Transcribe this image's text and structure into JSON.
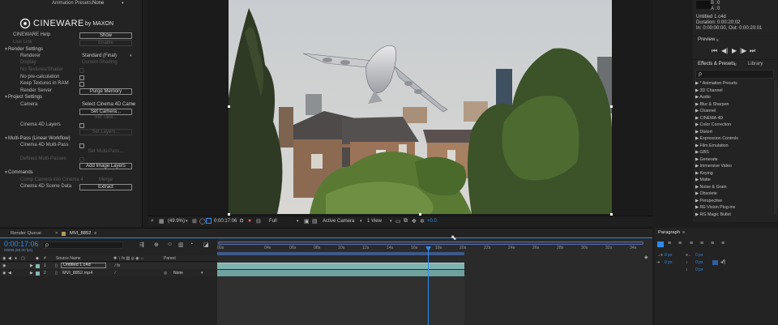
{
  "effect_controls": {
    "animation_presets_label": "Animation Presets:",
    "animation_presets_value": "None",
    "brand_name": "CINEWARE",
    "brand_by": "by MAXON",
    "help_label": "CINEWARE Help",
    "help_button": "Show",
    "live_link_label": "Live Link",
    "live_link_button": "Enable",
    "render_settings_label": "Render Settings",
    "renderer_label": "Renderer",
    "renderer_value": "Standard (Final)",
    "display_label": "Display",
    "display_value": "Current Shading",
    "no_textures_label": "No Textures/Shader",
    "no_precalc_label": "No pre-calculation",
    "keep_textures_label": "Keep Textures in RAM",
    "render_server_label": "Render Server",
    "render_server_button": "Purge Memory",
    "project_settings_label": "Project Settings",
    "camera_label": "Camera",
    "camera_value": "Select Cinema 4D Came",
    "set_camera_button": "Set Camera...",
    "set_take_button": "Set Take...",
    "c4d_layers_label": "Cinema 4D Layers",
    "set_layers_button": "Set Layers...",
    "multipass_label": "Multi-Pass (Linear Workflow)",
    "c4d_multipass_label": "Cinema 4D Multi-Pass",
    "set_multipass_button": "Set Multi-Pass...",
    "defined_multipasses_label": "Defined Multi-Passes",
    "add_image_layers_button": "Add Image Layers",
    "commands_label": "Commands",
    "comp_camera_label": "Comp Camera into Cinema 4",
    "merge_button": "Merge",
    "c4d_scene_data_label": "Cinema 4D Scene Data",
    "extract_button": "Extract"
  },
  "viewer_toolbar": {
    "zoom": "(49.9%)",
    "timecode": "0:00:17:06",
    "resolution": "Full",
    "camera": "Active Camera",
    "views": "1 View",
    "exposure": "+0.0"
  },
  "info_panel": {
    "b_label": "B :",
    "b_value": "0",
    "a_label": "A :",
    "a_value": "0",
    "comp_name": "Untitled 1.c4d",
    "duration": "Duration: 0:00:20:02",
    "in_out": "In: 0:00:00:00, Out: 0:00:20:01"
  },
  "preview_panel": {
    "title": "Preview"
  },
  "effects_panel": {
    "tab_effects": "Effects & Presets",
    "tab_library": "Library",
    "search_placeholder": "ρ",
    "items": [
      "* Animation Presets",
      "3D Channel",
      "Audio",
      "Blur & Sharpen",
      "Channel",
      "CINEMA 4D",
      "Color Correction",
      "Distort",
      "Expression Controls",
      "Film Emulation",
      "GBS",
      "Generate",
      "Immersive Video",
      "Keying",
      "Matte",
      "Noise & Grain",
      "Obsolete",
      "Perspective",
      "RE:Vision Plug-ins",
      "RG Magic Bullet"
    ]
  },
  "timeline": {
    "tab_render_queue": "Render Queue",
    "tab_comp": "MVI_8852",
    "current_time": "0:00:17:06",
    "frame_info": "00856 (50.00 fps)",
    "search_placeholder": "ρ",
    "col_source_name": "Source Name",
    "col_parent": "Parent",
    "ruler_ticks": [
      "00s",
      "04s",
      "06s",
      "08s",
      "10s",
      "12s",
      "14s",
      "16s",
      "18s",
      "20s",
      "22s",
      "24s",
      "26s",
      "28s",
      "30s",
      "32s",
      "34s"
    ],
    "layers": [
      {
        "num": "1",
        "name": "Untitled 1.c4d",
        "parent": ""
      },
      {
        "num": "2",
        "name": "MVI_8852.mp4",
        "parent": "None"
      }
    ]
  },
  "paragraph_panel": {
    "title": "Paragraph",
    "indent_values": [
      "0 px",
      "0 px",
      "0 px",
      "0 px",
      "0 px"
    ]
  },
  "colors": {
    "accent_blue": "#2d8ceb",
    "layer_bar": "#7fb3b0",
    "panel_bg": "#232323"
  }
}
